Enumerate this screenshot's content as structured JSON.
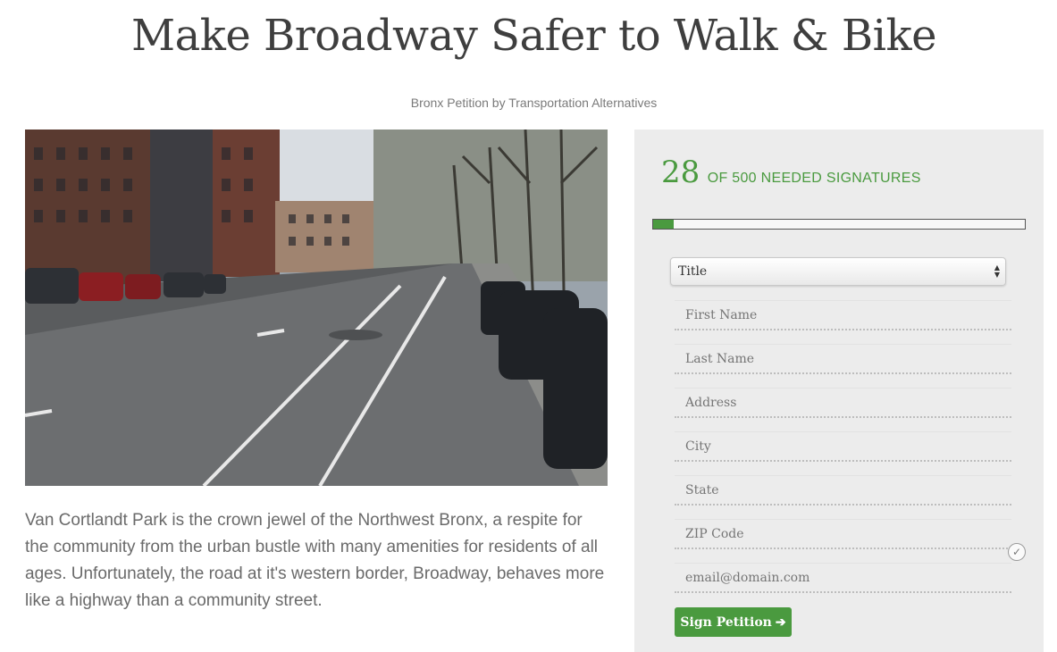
{
  "page": {
    "title": "Make Broadway Safer to Walk & Bike",
    "byline": "Bronx Petition by Transportation Alternatives"
  },
  "description": "Van Cortlandt Park is the crown jewel of the Northwest Bronx, a respite for the community from the urban bustle with many amenities for residents of all ages. Unfortunately, the road at it's western border, Broadway, behaves more like a highway than a community street.",
  "petition": {
    "signature_count": "28",
    "signature_label": "OF 500 NEEDED SIGNATURES",
    "progress_fraction": 0.056,
    "accent_color": "#4a9a3f"
  },
  "form": {
    "title_select": "Title",
    "placeholders": {
      "first_name": "First Name",
      "last_name": "Last Name",
      "address": "Address",
      "city": "City",
      "state": "State",
      "zip": "ZIP Code",
      "email": "email@domain.com"
    },
    "submit_label": "Sign Petition",
    "submit_icon": "arrow-right-icon",
    "opt_in_icon": "checkmark-icon"
  }
}
